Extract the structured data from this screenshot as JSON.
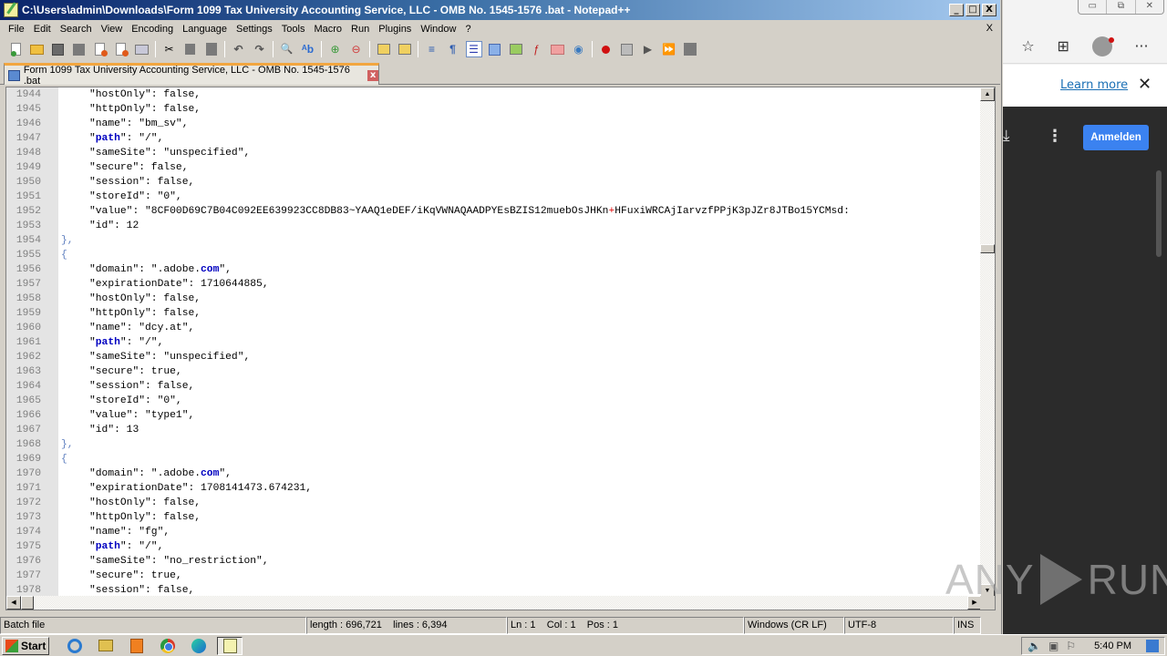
{
  "window": {
    "title": "C:\\Users\\admin\\Downloads\\Form 1099 Tax University Accounting Service, LLC - OMB No. 1545-1576 .bat - Notepad++",
    "buttons": {
      "minimize": "_",
      "maximize": "□",
      "close": "X"
    }
  },
  "menu": {
    "items": [
      "File",
      "Edit",
      "Search",
      "View",
      "Encoding",
      "Language",
      "Settings",
      "Tools",
      "Macro",
      "Run",
      "Plugins",
      "Window",
      "?"
    ],
    "close_doc": "X"
  },
  "toolbar": {
    "icons": [
      "new-file-icon",
      "open-file-icon",
      "save-icon",
      "save-all-icon",
      "close-icon",
      "close-all-icon",
      "print-icon",
      "cut-icon",
      "copy-icon",
      "paste-icon",
      "undo-icon",
      "redo-icon",
      "find-icon",
      "replace-icon",
      "zoom-in-icon",
      "zoom-out-icon",
      "sync-vertical-icon",
      "sync-horizontal-icon",
      "word-wrap-icon",
      "show-all-chars-icon",
      "indent-guide-icon",
      "language-udl-icon",
      "document-map-icon",
      "function-list-icon",
      "folder-as-workspace-icon",
      "monitoring-icon",
      "record-macro-icon",
      "stop-recording-icon",
      "playback-macro-icon",
      "run-macro-multiple-icon",
      "save-macro-icon"
    ]
  },
  "tab": {
    "label": "Form 1099 Tax University Accounting Service, LLC - OMB No. 1545-1576 .bat",
    "close": "x"
  },
  "editor": {
    "lines": [
      {
        "n": "1944",
        "indent": 1,
        "parts": [
          {
            "t": "\"hostOnly\": false,"
          }
        ]
      },
      {
        "n": "1945",
        "indent": 1,
        "parts": [
          {
            "t": "\"httpOnly\": false,"
          }
        ]
      },
      {
        "n": "1946",
        "indent": 1,
        "parts": [
          {
            "t": "\"name\": \"bm_sv\","
          }
        ]
      },
      {
        "n": "1947",
        "indent": 1,
        "parts": [
          {
            "t": "\""
          },
          {
            "t": "path",
            "c": "kw"
          },
          {
            "t": "\": \"/\","
          }
        ]
      },
      {
        "n": "1948",
        "indent": 1,
        "parts": [
          {
            "t": "\"sameSite\": \"unspecified\","
          }
        ]
      },
      {
        "n": "1949",
        "indent": 1,
        "parts": [
          {
            "t": "\"secure\": false,"
          }
        ]
      },
      {
        "n": "1950",
        "indent": 1,
        "parts": [
          {
            "t": "\"session\": false,"
          }
        ]
      },
      {
        "n": "1951",
        "indent": 1,
        "parts": [
          {
            "t": "\"storeId\": \"0\","
          }
        ]
      },
      {
        "n": "1952",
        "indent": 1,
        "parts": [
          {
            "t": "\"value\": \"8CF00D69C7B04C092EE639923CC8DB83~YAAQ1eDEF/iKqVWNAQAADPYEsBZIS12muebOsJHKn"
          },
          {
            "t": "+",
            "c": "plus"
          },
          {
            "t": "HFuxiWRCAjIarvzfPPjK3pJZr8JTBo15YCMsd:"
          }
        ]
      },
      {
        "n": "1953",
        "indent": 1,
        "parts": [
          {
            "t": "\"id\": 12"
          }
        ]
      },
      {
        "n": "1954",
        "indent": 0,
        "parts": [
          {
            "t": "},",
            "c": "brace"
          }
        ]
      },
      {
        "n": "1955",
        "indent": 0,
        "parts": [
          {
            "t": "{",
            "c": "brace"
          }
        ]
      },
      {
        "n": "1956",
        "indent": 1,
        "parts": [
          {
            "t": "\"domain\": \".adobe."
          },
          {
            "t": "com",
            "c": "kw"
          },
          {
            "t": "\","
          }
        ]
      },
      {
        "n": "1957",
        "indent": 1,
        "parts": [
          {
            "t": "\"expirationDate\": 1710644885,"
          }
        ]
      },
      {
        "n": "1958",
        "indent": 1,
        "parts": [
          {
            "t": "\"hostOnly\": false,"
          }
        ]
      },
      {
        "n": "1959",
        "indent": 1,
        "parts": [
          {
            "t": "\"httpOnly\": false,"
          }
        ]
      },
      {
        "n": "1960",
        "indent": 1,
        "parts": [
          {
            "t": "\"name\": \"dcy.at\","
          }
        ]
      },
      {
        "n": "1961",
        "indent": 1,
        "parts": [
          {
            "t": "\""
          },
          {
            "t": "path",
            "c": "kw"
          },
          {
            "t": "\": \"/\","
          }
        ]
      },
      {
        "n": "1962",
        "indent": 1,
        "parts": [
          {
            "t": "\"sameSite\": \"unspecified\","
          }
        ]
      },
      {
        "n": "1963",
        "indent": 1,
        "parts": [
          {
            "t": "\"secure\": true,"
          }
        ]
      },
      {
        "n": "1964",
        "indent": 1,
        "parts": [
          {
            "t": "\"session\": false,"
          }
        ]
      },
      {
        "n": "1965",
        "indent": 1,
        "parts": [
          {
            "t": "\"storeId\": \"0\","
          }
        ]
      },
      {
        "n": "1966",
        "indent": 1,
        "parts": [
          {
            "t": "\"value\": \"type1\","
          }
        ]
      },
      {
        "n": "1967",
        "indent": 1,
        "parts": [
          {
            "t": "\"id\": 13"
          }
        ]
      },
      {
        "n": "1968",
        "indent": 0,
        "parts": [
          {
            "t": "},",
            "c": "brace"
          }
        ]
      },
      {
        "n": "1969",
        "indent": 0,
        "parts": [
          {
            "t": "{",
            "c": "brace"
          }
        ]
      },
      {
        "n": "1970",
        "indent": 1,
        "parts": [
          {
            "t": "\"domain\": \".adobe."
          },
          {
            "t": "com",
            "c": "kw"
          },
          {
            "t": "\","
          }
        ]
      },
      {
        "n": "1971",
        "indent": 1,
        "parts": [
          {
            "t": "\"expirationDate\": 1708141473.674231,"
          }
        ]
      },
      {
        "n": "1972",
        "indent": 1,
        "parts": [
          {
            "t": "\"hostOnly\": false,"
          }
        ]
      },
      {
        "n": "1973",
        "indent": 1,
        "parts": [
          {
            "t": "\"httpOnly\": false,"
          }
        ]
      },
      {
        "n": "1974",
        "indent": 1,
        "parts": [
          {
            "t": "\"name\": \"fg\","
          }
        ]
      },
      {
        "n": "1975",
        "indent": 1,
        "parts": [
          {
            "t": "\""
          },
          {
            "t": "path",
            "c": "kw"
          },
          {
            "t": "\": \"/\","
          }
        ]
      },
      {
        "n": "1976",
        "indent": 1,
        "parts": [
          {
            "t": "\"sameSite\": \"no_restriction\","
          }
        ]
      },
      {
        "n": "1977",
        "indent": 1,
        "parts": [
          {
            "t": "\"secure\": true,"
          }
        ]
      },
      {
        "n": "1978",
        "indent": 1,
        "parts": [
          {
            "t": "\"session\": false,"
          }
        ]
      }
    ]
  },
  "statusbar": {
    "file_type": "Batch file",
    "length": "length : 696,721",
    "lines": "lines : 6,394",
    "ln": "Ln : 1",
    "col": "Col : 1",
    "pos": "Pos : 1",
    "eol": "Windows (CR LF)",
    "encoding": "UTF-8",
    "mode": "INS"
  },
  "edge": {
    "learn_more": "Learn more",
    "banner_close": "✕",
    "signin_button": "Anmelden",
    "window_buttons": [
      "▭",
      "⧉",
      "✕"
    ]
  },
  "watermark": {
    "left": "ANY",
    "right": "RUN"
  },
  "taskbar": {
    "start_label": "Start",
    "apps": [
      "internet-explorer",
      "file-explorer",
      "media-player",
      "chrome",
      "edge",
      "notepad-plus-plus"
    ],
    "clock": "5:40 PM"
  },
  "colors": {
    "keyword": "#0000c0",
    "brace": "#6080c0",
    "tab_accent": "#f2a640",
    "signin_blue": "#3b82f0"
  }
}
